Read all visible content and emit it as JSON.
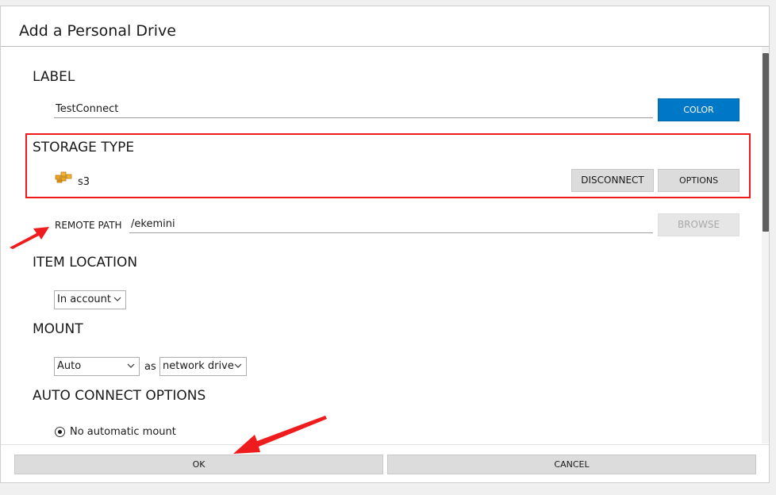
{
  "dialog": {
    "title": "Add a Personal Drive"
  },
  "label_section": {
    "title": "LABEL",
    "value": "TestConnect",
    "color_button": "COLOR"
  },
  "storage_type": {
    "title": "STORAGE TYPE",
    "icon": "aws-icon",
    "value": "s3",
    "disconnect_button": "DISCONNECT",
    "options_button": "OPTIONS"
  },
  "remote_path": {
    "label": "REMOTE PATH",
    "value": "/ekemini",
    "browse_button": "BROWSE"
  },
  "item_location": {
    "title": "ITEM LOCATION",
    "selected": "In account"
  },
  "mount": {
    "title": "MOUNT",
    "mode_selected": "Auto",
    "as_label": "as",
    "type_selected": "network drive"
  },
  "auto_connect": {
    "title": "AUTO CONNECT OPTIONS",
    "options": [
      {
        "label": "No automatic mount",
        "selected": true
      }
    ]
  },
  "footer": {
    "ok_button": "OK",
    "cancel_button": "CANCEL"
  },
  "colors": {
    "accent": "#0078c8",
    "highlight": "#ef1a1a",
    "arrow": "#ee1c1c"
  }
}
